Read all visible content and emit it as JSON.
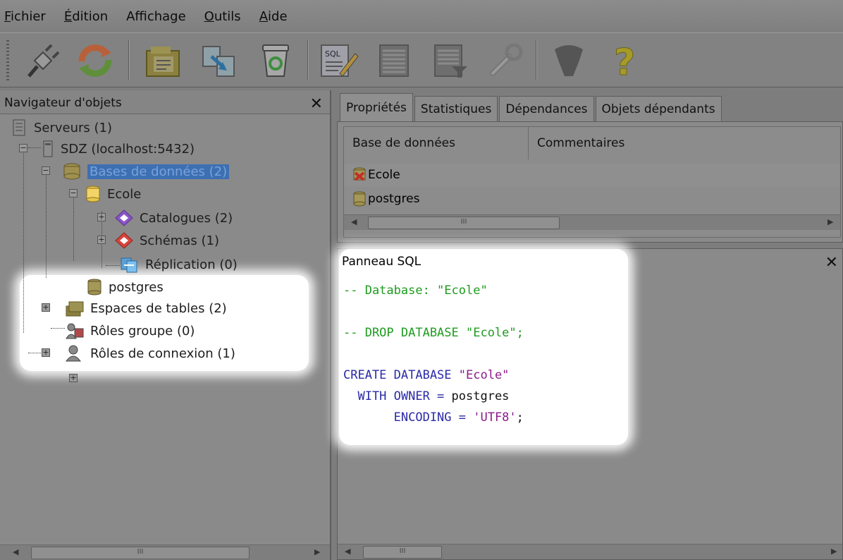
{
  "menu": [
    {
      "first": "F",
      "rest": "ichier"
    },
    {
      "first": "É",
      "rest": "dition"
    },
    {
      "first": "Affichage",
      "rest": ""
    },
    {
      "first": "O",
      "rest": "utils"
    },
    {
      "first": "A",
      "rest": "ide"
    }
  ],
  "toolbar": {
    "icons": [
      "plug-icon",
      "refresh-icon",
      "properties-icon",
      "copy-icon",
      "delete-icon",
      "sql-editor-icon",
      "table-view-icon",
      "filtered-view-icon",
      "wrench-icon",
      "plugin-icon",
      "help-icon"
    ]
  },
  "navigator": {
    "title": "Navigateur d'objets",
    "close": "✕",
    "nodes": {
      "servers": "Serveurs (1)",
      "server": "SDZ (localhost:5432)",
      "databases": "Bases de données (2)",
      "ecole": "Ecole",
      "catalogues": "Catalogues (2)",
      "schemas": "Schémas (1)",
      "replication": "Réplication (0)",
      "postgres": "postgres",
      "tablespaces": "Espaces de tables (2)",
      "group_roles": "Rôles groupe (0)",
      "login_roles": "Rôles de connexion (1)"
    },
    "scroll_thumb": "III"
  },
  "tabs": [
    "Propriétés",
    "Statistiques",
    "Dépendances",
    "Objets dépendants"
  ],
  "properties": {
    "columns": [
      "Base de données",
      "Commentaires"
    ],
    "rows": [
      "Ecole",
      "postgres"
    ],
    "scroll_thumb": "III"
  },
  "sql_panel": {
    "title": "Panneau SQL",
    "close": "✕",
    "line1": "-- Database: \"Ecole\"",
    "line2": "-- DROP DATABASE \"Ecole\";",
    "line3_kw": "CREATE DATABASE ",
    "line3_str": "\"Ecole\"",
    "line4_kw": "  WITH OWNER = ",
    "line4_val": "postgres",
    "line5_kw": "       ENCODING = ",
    "line5_str": "'UTF8'",
    "line5_end": ";",
    "scroll_thumb": "III"
  },
  "colors": {
    "selection": "#3d6fb3",
    "comment": "#1e9c1e",
    "keyword": "#2a2aa8",
    "string": "#8c1a8c"
  }
}
